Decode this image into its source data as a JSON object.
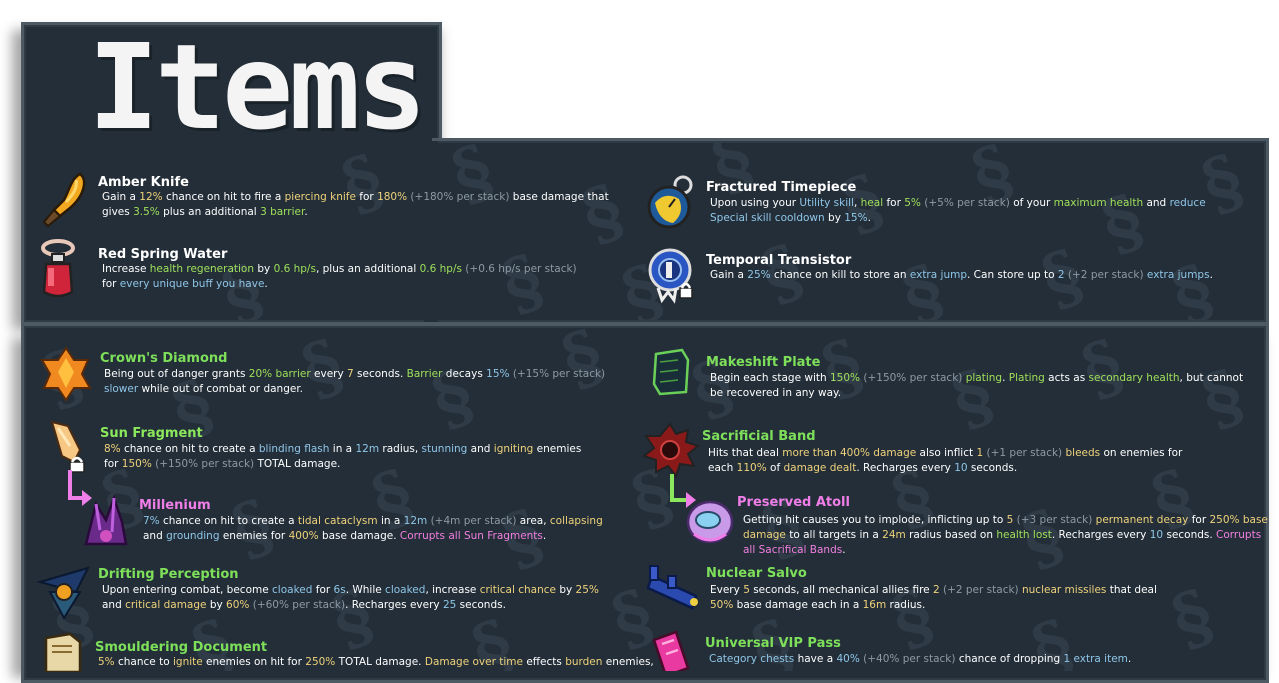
{
  "title": "Items",
  "colors": {
    "panel_bg": "#232e38",
    "panel_border": "#4e5a63",
    "utility": "#8fc6e8",
    "damage": "#efd27b",
    "healing": "#9fe05a",
    "stack": "#8e9aa3",
    "void": "#f27fe0"
  },
  "white_items": [
    {
      "name": "Amber Knife",
      "icon": "amber-knife-icon",
      "desc": [
        [
          [
            "w",
            "Gain a "
          ],
          [
            "y",
            "12%"
          ],
          [
            "w",
            " chance on hit to fire a "
          ],
          [
            "y",
            "piercing knife"
          ],
          [
            "w",
            " for "
          ],
          [
            "y",
            "180%"
          ],
          [
            "s",
            " (+180% per stack)"
          ],
          [
            "w",
            " base damage that"
          ]
        ],
        [
          [
            "w",
            "gives "
          ],
          [
            "g",
            "3.5%"
          ],
          [
            "w",
            " plus an additional "
          ],
          [
            "g",
            "3 barrier"
          ],
          [
            "w",
            "."
          ]
        ]
      ]
    },
    {
      "name": "Red Spring Water",
      "icon": "red-spring-water-icon",
      "desc": [
        [
          [
            "w",
            "Increase "
          ],
          [
            "g",
            "health regeneration"
          ],
          [
            "w",
            " by "
          ],
          [
            "g",
            "0.6 hp/s"
          ],
          [
            "w",
            ", plus an additional "
          ],
          [
            "g",
            "0.6 hp/s"
          ],
          [
            "s",
            " (+0.6 hp/s per stack)"
          ]
        ],
        [
          [
            "w",
            "for "
          ],
          [
            "b",
            "every unique buff you have"
          ],
          [
            "w",
            "."
          ]
        ]
      ]
    },
    {
      "name": "Fractured Timepiece",
      "icon": "fractured-timepiece-icon",
      "desc": [
        [
          [
            "w",
            "Upon using your "
          ],
          [
            "b",
            "Utility skill"
          ],
          [
            "w",
            ", "
          ],
          [
            "g",
            "heal"
          ],
          [
            "w",
            " for "
          ],
          [
            "g",
            "5%"
          ],
          [
            "s",
            " (+5% per stack)"
          ],
          [
            "w",
            " of your "
          ],
          [
            "g",
            "maximum health"
          ],
          [
            "w",
            " and "
          ],
          [
            "b",
            "reduce"
          ]
        ],
        [
          [
            "b",
            "Special skill cooldown"
          ],
          [
            "w",
            " by "
          ],
          [
            "b",
            "15%"
          ],
          [
            "w",
            "."
          ]
        ]
      ]
    },
    {
      "name": "Temporal Transistor",
      "icon": "temporal-transistor-icon",
      "desc": [
        [
          [
            "w",
            "Gain a "
          ],
          [
            "b",
            "25%"
          ],
          [
            "w",
            " chance on kill to store an "
          ],
          [
            "b",
            "extra jump"
          ],
          [
            "w",
            ". Can store up to "
          ],
          [
            "b",
            "2"
          ],
          [
            "s",
            " (+2 per stack)"
          ],
          [
            "w",
            " "
          ],
          [
            "b",
            "extra jumps"
          ],
          [
            "w",
            "."
          ]
        ]
      ]
    }
  ],
  "green_items": [
    {
      "name": "Crown's Diamond",
      "icon": "crowns-diamond-icon",
      "desc": [
        [
          [
            "w",
            "Being out of danger grants "
          ],
          [
            "g",
            "20% barrier"
          ],
          [
            "w",
            " every "
          ],
          [
            "y",
            "7"
          ],
          [
            "w",
            " seconds. "
          ],
          [
            "g",
            "Barrier"
          ],
          [
            "w",
            " decays "
          ],
          [
            "b",
            "15%"
          ],
          [
            "s",
            " (+15% per stack)"
          ]
        ],
        [
          [
            "b",
            "slower"
          ],
          [
            "w",
            " while out of combat or danger."
          ]
        ]
      ]
    },
    {
      "name": "Sun Fragment",
      "icon": "sun-fragment-icon",
      "desc": [
        [
          [
            "y",
            "8%"
          ],
          [
            "w",
            " chance on hit to create a "
          ],
          [
            "b",
            "blinding flash"
          ],
          [
            "w",
            " in a "
          ],
          [
            "b",
            "12m"
          ],
          [
            "w",
            " radius, "
          ],
          [
            "b",
            "stunning"
          ],
          [
            "w",
            " and "
          ],
          [
            "y",
            "igniting"
          ],
          [
            "w",
            " enemies"
          ]
        ],
        [
          [
            "w",
            "for "
          ],
          [
            "y",
            "150%"
          ],
          [
            "s",
            " (+150% per stack)"
          ],
          [
            "w",
            " TOTAL damage."
          ]
        ]
      ]
    },
    {
      "name": "Millenium",
      "icon": "millenium-icon",
      "desc": [
        [
          [
            "b",
            "7%"
          ],
          [
            "w",
            " chance on hit to create a "
          ],
          [
            "y",
            "tidal cataclysm"
          ],
          [
            "w",
            " in a "
          ],
          [
            "b",
            "12m"
          ],
          [
            "s",
            " (+4m per stack)"
          ],
          [
            "w",
            " area, "
          ],
          [
            "y",
            "collapsing"
          ]
        ],
        [
          [
            "w",
            "and "
          ],
          [
            "b",
            "grounding"
          ],
          [
            "w",
            " enemies for "
          ],
          [
            "y",
            "400%"
          ],
          [
            "w",
            " base damage. "
          ],
          [
            "p",
            "Corrupts all Sun Fragments"
          ],
          [
            "w",
            "."
          ]
        ]
      ]
    },
    {
      "name": "Drifting Perception",
      "icon": "drifting-perception-icon",
      "desc": [
        [
          [
            "w",
            "Upon entering combat, become "
          ],
          [
            "b",
            "cloaked"
          ],
          [
            "w",
            " for "
          ],
          [
            "b",
            "6s"
          ],
          [
            "w",
            ". While "
          ],
          [
            "b",
            "cloaked"
          ],
          [
            "w",
            ", increase "
          ],
          [
            "y",
            "critical chance"
          ],
          [
            "w",
            " by "
          ],
          [
            "y",
            "25%"
          ]
        ],
        [
          [
            "w",
            "and "
          ],
          [
            "y",
            "critical damage"
          ],
          [
            "w",
            " by "
          ],
          [
            "y",
            "60%"
          ],
          [
            "s",
            " (+60% per stack)"
          ],
          [
            "w",
            ". Recharges every "
          ],
          [
            "b",
            "25"
          ],
          [
            "w",
            " seconds."
          ]
        ]
      ]
    },
    {
      "name": "Smouldering Document",
      "icon": "smouldering-document-icon",
      "desc": [
        [
          [
            "y",
            "5%"
          ],
          [
            "w",
            " chance to "
          ],
          [
            "y",
            "ignite"
          ],
          [
            "w",
            " enemies on hit for "
          ],
          [
            "y",
            "250%"
          ],
          [
            "w",
            " TOTAL damage. "
          ],
          [
            "y",
            "Damage over time"
          ],
          [
            "w",
            " effects "
          ],
          [
            "y",
            "burden"
          ],
          [
            "w",
            " enemies,"
          ]
        ]
      ]
    },
    {
      "name": "Makeshift Plate",
      "icon": "makeshift-plate-icon",
      "desc": [
        [
          [
            "w",
            "Begin each stage with "
          ],
          [
            "g",
            "150%"
          ],
          [
            "s",
            " (+150% per stack)"
          ],
          [
            "w",
            " "
          ],
          [
            "g",
            "plating"
          ],
          [
            "w",
            ". "
          ],
          [
            "g",
            "Plating"
          ],
          [
            "w",
            " acts as "
          ],
          [
            "g",
            "secondary health"
          ],
          [
            "w",
            ", but cannot"
          ]
        ],
        [
          [
            "w",
            "be recovered in any way."
          ]
        ]
      ]
    },
    {
      "name": "Sacrificial Band",
      "icon": "sacrificial-band-icon",
      "desc": [
        [
          [
            "w",
            "Hits that deal "
          ],
          [
            "y",
            "more than 400% damage"
          ],
          [
            "w",
            " also inflict "
          ],
          [
            "y",
            "1"
          ],
          [
            "s",
            " (+1 per stack)"
          ],
          [
            "w",
            " "
          ],
          [
            "y",
            "bleeds"
          ],
          [
            "w",
            " on enemies for"
          ]
        ],
        [
          [
            "w",
            "each "
          ],
          [
            "y",
            "110%"
          ],
          [
            "w",
            " of "
          ],
          [
            "y",
            "damage dealt"
          ],
          [
            "w",
            ". Recharges every "
          ],
          [
            "b",
            "10"
          ],
          [
            "w",
            " seconds."
          ]
        ]
      ]
    },
    {
      "name": "Preserved Atoll",
      "icon": "preserved-atoll-icon",
      "desc": [
        [
          [
            "w",
            "Getting hit causes you to implode, inflicting up to "
          ],
          [
            "y",
            "5"
          ],
          [
            "s",
            " (+3 per stack)"
          ],
          [
            "w",
            " "
          ],
          [
            "y",
            "permanent decay"
          ],
          [
            "w",
            " for "
          ],
          [
            "y",
            "250% base"
          ]
        ],
        [
          [
            "y",
            "damage"
          ],
          [
            "w",
            " to all targets in a "
          ],
          [
            "y",
            "24m"
          ],
          [
            "w",
            " radius based on "
          ],
          [
            "g",
            "health lost"
          ],
          [
            "w",
            ". Recharges every "
          ],
          [
            "b",
            "10"
          ],
          [
            "w",
            " seconds. "
          ],
          [
            "p",
            "Corrupts"
          ]
        ],
        [
          [
            "p",
            "all Sacrifical Bands"
          ],
          [
            "w",
            "."
          ]
        ]
      ]
    },
    {
      "name": "Nuclear Salvo",
      "icon": "nuclear-salvo-icon",
      "desc": [
        [
          [
            "w",
            "Every "
          ],
          [
            "y",
            "5"
          ],
          [
            "w",
            " seconds, all mechanical allies fire "
          ],
          [
            "y",
            "2"
          ],
          [
            "s",
            " (+2 per stack)"
          ],
          [
            "w",
            " "
          ],
          [
            "y",
            "nuclear missiles"
          ],
          [
            "w",
            " that deal"
          ]
        ],
        [
          [
            "y",
            "50%"
          ],
          [
            "w",
            " base damage each in a "
          ],
          [
            "y",
            "16m"
          ],
          [
            "w",
            " radius."
          ]
        ]
      ]
    },
    {
      "name": "Universal VIP Pass",
      "icon": "universal-vip-pass-icon",
      "desc": [
        [
          [
            "b",
            "Category chests"
          ],
          [
            "w",
            " have a "
          ],
          [
            "b",
            "40%"
          ],
          [
            "s",
            " (+40% per stack)"
          ],
          [
            "w",
            " chance of dropping "
          ],
          [
            "b",
            "1 extra item"
          ],
          [
            "w",
            "."
          ]
        ]
      ]
    }
  ]
}
